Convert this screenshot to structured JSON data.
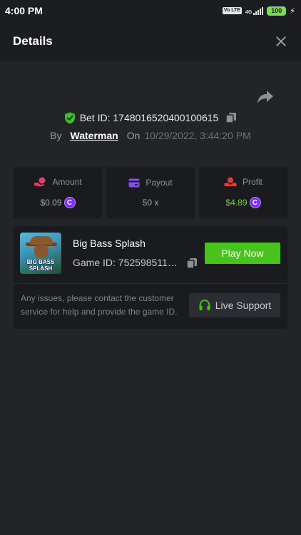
{
  "status_bar": {
    "time": "4:00 PM",
    "volte": "Vo LTE",
    "network": "4G",
    "battery": "100"
  },
  "header": {
    "title": "Details"
  },
  "bet": {
    "id_label": "Bet ID: 1748016520400100615",
    "by_label": "By",
    "username": "Waterman",
    "on_label": "On",
    "date": "10/29/2022, 3:44:20 PM"
  },
  "stats": [
    {
      "label": "Amount",
      "value": "$0.09",
      "icon": "coin-hand-icon",
      "coin": true
    },
    {
      "label": "Payout",
      "value": "50 x",
      "icon": "wallet-icon",
      "coin": false
    },
    {
      "label": "Profit",
      "value": "$4.89",
      "icon": "profit-hands-icon",
      "coin": true
    }
  ],
  "game": {
    "name": "Big Bass Splash",
    "id_label": "Game ID: 7525985118...",
    "thumb_text": "BIG BASS SPLASH",
    "play_label": "Play Now",
    "issue_text": "Any issues, please contact the customer service for help and provide the game ID.",
    "support_label": "Live Support"
  },
  "colors": {
    "accent_green": "#48c21c",
    "profit_green": "#6ad63e",
    "coin_purple": "#7b2ff0",
    "background": "#232428",
    "card": "#1a1b1e"
  },
  "coin_symbol": "C"
}
